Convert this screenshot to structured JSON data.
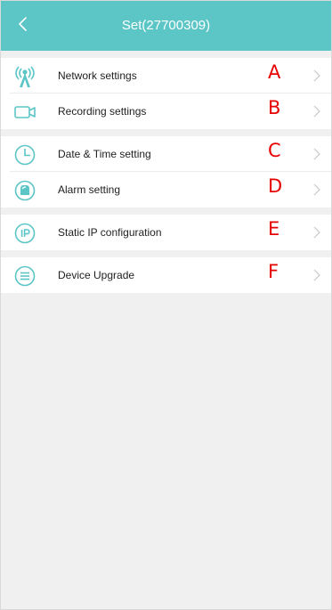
{
  "header": {
    "title": "Set(27700309)",
    "back_icon": "chevron-left-icon",
    "background_color": "#5cc5c6"
  },
  "settings": [
    {
      "label": "Network settings",
      "marker": "A",
      "icon": "antenna-icon"
    },
    {
      "label": "Recording settings",
      "marker": "B",
      "icon": "video-camera-icon"
    },
    {
      "label": "Date & Time setting",
      "marker": "C",
      "icon": "clock-icon"
    },
    {
      "label": "Alarm setting",
      "marker": "D",
      "icon": "alarm-bell-icon"
    },
    {
      "label": "Static IP configuration",
      "marker": "E",
      "icon": "ip-icon"
    },
    {
      "label": "Device Upgrade",
      "marker": "F",
      "icon": "list-icon"
    }
  ],
  "colors": {
    "accent": "#5cc5c6",
    "marker": "#e60000",
    "chevron": "#c8c8c8",
    "background": "#f0f0f0"
  }
}
